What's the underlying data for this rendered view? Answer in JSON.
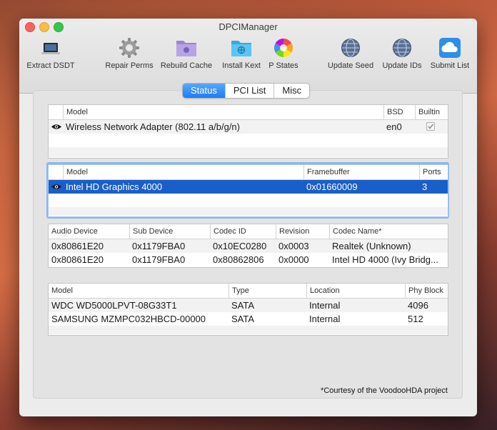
{
  "window": {
    "title": "DPCIManager"
  },
  "toolbar": [
    {
      "label": "Extract DSDT",
      "icon": "laptop-icon"
    },
    {
      "label": "Repair Perms",
      "icon": "gear-icon"
    },
    {
      "label": "Rebuild Cache",
      "icon": "folder-icon"
    },
    {
      "label": "Install Kext",
      "icon": "folder-icon"
    },
    {
      "label": "P States",
      "icon": "color-wheel-icon"
    },
    {
      "label": "Update Seed",
      "icon": "globe-icon"
    },
    {
      "label": "Update IDs",
      "icon": "globe-icon"
    },
    {
      "label": "Submit List",
      "icon": "cloud-icon"
    }
  ],
  "tabs": [
    {
      "label": "Status",
      "selected": true
    },
    {
      "label": "PCI List",
      "selected": false
    },
    {
      "label": "Misc",
      "selected": false
    }
  ],
  "network": {
    "headers": [
      "Model",
      "BSD",
      "Builtin"
    ],
    "rows": [
      {
        "model": "Wireless Network Adapter (802.11 a/b/g/n)",
        "bsd": "en0",
        "builtin": true
      }
    ]
  },
  "graphics": {
    "headers": [
      "Model",
      "Framebuffer",
      "Ports"
    ],
    "rows": [
      {
        "model": "Intel HD Graphics 4000",
        "framebuffer": "0x01660009",
        "ports": "3"
      }
    ]
  },
  "audio": {
    "headers": [
      "Audio Device",
      "Sub Device",
      "Codec ID",
      "Revision",
      "Codec Name*"
    ],
    "rows": [
      [
        "0x80861E20",
        "0x1179FBA0",
        "0x10EC0280",
        "0x0003",
        "Realtek (Unknown)"
      ],
      [
        "0x80861E20",
        "0x1179FBA0",
        "0x80862806",
        "0x0000",
        "Intel HD 4000 (Ivy Bridg..."
      ]
    ]
  },
  "storage": {
    "headers": [
      "Model",
      "Type",
      "Location",
      "Phy Block"
    ],
    "rows": [
      [
        "WDC WD5000LPVT-08G33T1",
        "SATA",
        "Internal",
        "4096"
      ],
      [
        "SAMSUNG MZMPC032HBCD-00000",
        "SATA",
        "Internal",
        "512"
      ]
    ]
  },
  "footnote": "*Courtesy of the VoodooHDA project",
  "colors": {
    "selection": "#1a5fc9",
    "tab_selected": "#1a7ef7",
    "focus_ring": "#8ab8ee"
  }
}
